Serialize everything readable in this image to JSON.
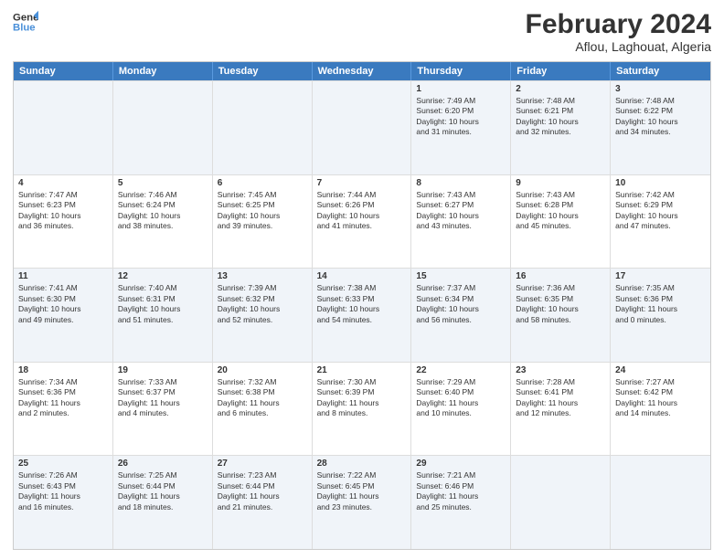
{
  "header": {
    "logo_line1": "General",
    "logo_line2": "Blue",
    "month_year": "February 2024",
    "location": "Aflou, Laghouat, Algeria"
  },
  "days_of_week": [
    "Sunday",
    "Monday",
    "Tuesday",
    "Wednesday",
    "Thursday",
    "Friday",
    "Saturday"
  ],
  "rows": [
    [
      {
        "day": "",
        "info": ""
      },
      {
        "day": "",
        "info": ""
      },
      {
        "day": "",
        "info": ""
      },
      {
        "day": "",
        "info": ""
      },
      {
        "day": "1",
        "info": "Sunrise: 7:49 AM\nSunset: 6:20 PM\nDaylight: 10 hours\nand 31 minutes."
      },
      {
        "day": "2",
        "info": "Sunrise: 7:48 AM\nSunset: 6:21 PM\nDaylight: 10 hours\nand 32 minutes."
      },
      {
        "day": "3",
        "info": "Sunrise: 7:48 AM\nSunset: 6:22 PM\nDaylight: 10 hours\nand 34 minutes."
      }
    ],
    [
      {
        "day": "4",
        "info": "Sunrise: 7:47 AM\nSunset: 6:23 PM\nDaylight: 10 hours\nand 36 minutes."
      },
      {
        "day": "5",
        "info": "Sunrise: 7:46 AM\nSunset: 6:24 PM\nDaylight: 10 hours\nand 38 minutes."
      },
      {
        "day": "6",
        "info": "Sunrise: 7:45 AM\nSunset: 6:25 PM\nDaylight: 10 hours\nand 39 minutes."
      },
      {
        "day": "7",
        "info": "Sunrise: 7:44 AM\nSunset: 6:26 PM\nDaylight: 10 hours\nand 41 minutes."
      },
      {
        "day": "8",
        "info": "Sunrise: 7:43 AM\nSunset: 6:27 PM\nDaylight: 10 hours\nand 43 minutes."
      },
      {
        "day": "9",
        "info": "Sunrise: 7:43 AM\nSunset: 6:28 PM\nDaylight: 10 hours\nand 45 minutes."
      },
      {
        "day": "10",
        "info": "Sunrise: 7:42 AM\nSunset: 6:29 PM\nDaylight: 10 hours\nand 47 minutes."
      }
    ],
    [
      {
        "day": "11",
        "info": "Sunrise: 7:41 AM\nSunset: 6:30 PM\nDaylight: 10 hours\nand 49 minutes."
      },
      {
        "day": "12",
        "info": "Sunrise: 7:40 AM\nSunset: 6:31 PM\nDaylight: 10 hours\nand 51 minutes."
      },
      {
        "day": "13",
        "info": "Sunrise: 7:39 AM\nSunset: 6:32 PM\nDaylight: 10 hours\nand 52 minutes."
      },
      {
        "day": "14",
        "info": "Sunrise: 7:38 AM\nSunset: 6:33 PM\nDaylight: 10 hours\nand 54 minutes."
      },
      {
        "day": "15",
        "info": "Sunrise: 7:37 AM\nSunset: 6:34 PM\nDaylight: 10 hours\nand 56 minutes."
      },
      {
        "day": "16",
        "info": "Sunrise: 7:36 AM\nSunset: 6:35 PM\nDaylight: 10 hours\nand 58 minutes."
      },
      {
        "day": "17",
        "info": "Sunrise: 7:35 AM\nSunset: 6:36 PM\nDaylight: 11 hours\nand 0 minutes."
      }
    ],
    [
      {
        "day": "18",
        "info": "Sunrise: 7:34 AM\nSunset: 6:36 PM\nDaylight: 11 hours\nand 2 minutes."
      },
      {
        "day": "19",
        "info": "Sunrise: 7:33 AM\nSunset: 6:37 PM\nDaylight: 11 hours\nand 4 minutes."
      },
      {
        "day": "20",
        "info": "Sunrise: 7:32 AM\nSunset: 6:38 PM\nDaylight: 11 hours\nand 6 minutes."
      },
      {
        "day": "21",
        "info": "Sunrise: 7:30 AM\nSunset: 6:39 PM\nDaylight: 11 hours\nand 8 minutes."
      },
      {
        "day": "22",
        "info": "Sunrise: 7:29 AM\nSunset: 6:40 PM\nDaylight: 11 hours\nand 10 minutes."
      },
      {
        "day": "23",
        "info": "Sunrise: 7:28 AM\nSunset: 6:41 PM\nDaylight: 11 hours\nand 12 minutes."
      },
      {
        "day": "24",
        "info": "Sunrise: 7:27 AM\nSunset: 6:42 PM\nDaylight: 11 hours\nand 14 minutes."
      }
    ],
    [
      {
        "day": "25",
        "info": "Sunrise: 7:26 AM\nSunset: 6:43 PM\nDaylight: 11 hours\nand 16 minutes."
      },
      {
        "day": "26",
        "info": "Sunrise: 7:25 AM\nSunset: 6:44 PM\nDaylight: 11 hours\nand 18 minutes."
      },
      {
        "day": "27",
        "info": "Sunrise: 7:23 AM\nSunset: 6:44 PM\nDaylight: 11 hours\nand 21 minutes."
      },
      {
        "day": "28",
        "info": "Sunrise: 7:22 AM\nSunset: 6:45 PM\nDaylight: 11 hours\nand 23 minutes."
      },
      {
        "day": "29",
        "info": "Sunrise: 7:21 AM\nSunset: 6:46 PM\nDaylight: 11 hours\nand 25 minutes."
      },
      {
        "day": "",
        "info": ""
      },
      {
        "day": "",
        "info": ""
      }
    ]
  ],
  "alt_rows": [
    0,
    2,
    4
  ],
  "colors": {
    "header_bg": "#3a7abf",
    "alt_row_bg": "#e8f0f8",
    "normal_row_bg": "#ffffff"
  }
}
